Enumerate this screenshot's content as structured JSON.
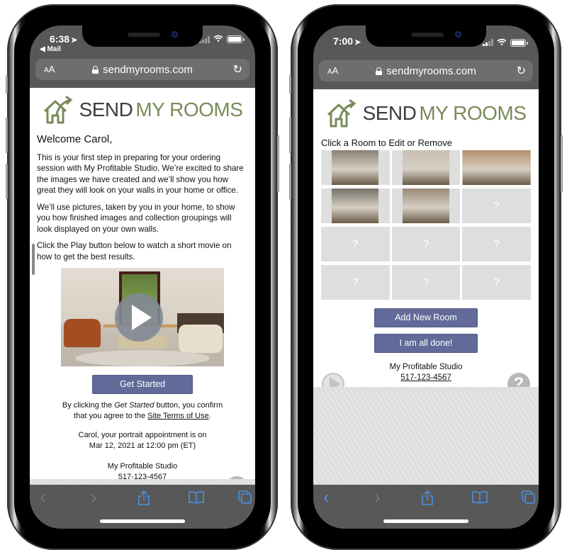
{
  "left_phone": {
    "status": {
      "time": "6:38",
      "back_app": "◀ Mail"
    },
    "urlbar": {
      "text_size": "AA",
      "url": "sendmyrooms.com"
    },
    "logo": {
      "send": "SEND",
      "my_rooms": "MY ROOMS"
    },
    "welcome": "Welcome Carol,",
    "paragraphs": [
      "This is your first step in preparing for your ordering session with My Profitable Studio. We’re excited to share the images we have created and we’ll show you how great they will look on your walls in your home or office.",
      "We’ll use pictures, taken by you in your home, to show you how finished images and collection groupings will look displayed on your own walls.",
      "Click the Play button below to watch a short movie on how to get the best results."
    ],
    "get_started_label": "Get Started",
    "terms": {
      "prefix": "By clicking the ",
      "emph": "Get Started",
      "middle": " button, you confirm",
      "line2_prefix": "that you agree to the ",
      "link": "Site Terms of Use",
      "suffix": "."
    },
    "appointment": {
      "line1": "Carol, your portrait appointment is on",
      "line2": "Mar 12, 2021 at 12:00 pm (ET)"
    },
    "studio_name": "My Profitable Studio",
    "phone": "517-123-4567",
    "help_icon": "?"
  },
  "right_phone": {
    "status": {
      "time": "7:00"
    },
    "urlbar": {
      "text_size": "AA",
      "url": "sendmyrooms.com"
    },
    "logo": {
      "send": "SEND",
      "my_rooms": "MY ROOMS"
    },
    "heading": "Click a Room to Edit or Remove",
    "rooms": [
      {
        "type": "photo",
        "label": "living room with window",
        "bg": "#8a8076"
      },
      {
        "type": "photo",
        "label": "living room with sofa",
        "bg": "#c9bfb2"
      },
      {
        "type": "photo",
        "label": "staircase",
        "bg": "#b48f6a"
      },
      {
        "type": "photo",
        "label": "bedroom",
        "bg": "#757268"
      },
      {
        "type": "photo",
        "label": "fireplace room",
        "bg": "#9a8a76"
      },
      {
        "type": "empty",
        "label": "?"
      },
      {
        "type": "empty",
        "label": "?"
      },
      {
        "type": "empty",
        "label": "?"
      },
      {
        "type": "empty",
        "label": "?"
      },
      {
        "type": "empty",
        "label": "?"
      },
      {
        "type": "empty",
        "label": "?"
      },
      {
        "type": "empty",
        "label": "?"
      }
    ],
    "add_room_label": "Add New Room",
    "done_label": "I am all done!",
    "studio_name": "My Profitable Studio",
    "phone": "517-123-4567",
    "help_icon": "?"
  },
  "toolbar": {
    "back": "‹",
    "forward": "›",
    "share": "share",
    "bookmarks": "bookmarks",
    "tabs": "tabs"
  },
  "colors": {
    "brand_green": "#7a8a5a",
    "brand_dark": "#3d3d3d",
    "button": "#616a98",
    "ios_blue": "#4a90e2",
    "placeholder": "#dedede"
  }
}
